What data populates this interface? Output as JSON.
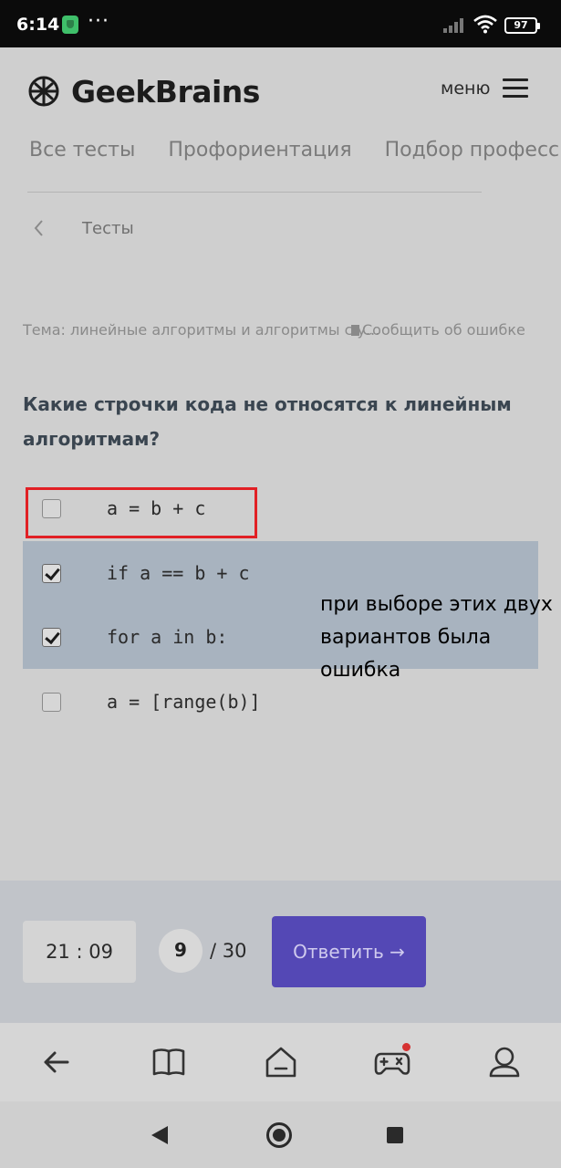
{
  "status_bar": {
    "time": "6:14",
    "more": "···",
    "battery": "97"
  },
  "header": {
    "logo_text": "GeekBrains",
    "menu_label": "меню"
  },
  "tabs": [
    "Все тесты",
    "Профориентация",
    "Подбор профессии"
  ],
  "breadcrumb": {
    "label": "Тесты"
  },
  "topic": {
    "text": "Тема: линейные алгоритмы и алгоритмы с у...",
    "report_label": "Сообщить об ошибке"
  },
  "question": {
    "text": "Какие строчки кода не относятся к линейным алгоритмам?"
  },
  "answers": [
    {
      "code": "a = b + c",
      "checked": false
    },
    {
      "code": "if a == b + c",
      "checked": true
    },
    {
      "code": "for a in b:",
      "checked": true
    },
    {
      "code": "a = [range(b)]",
      "checked": false
    }
  ],
  "annotation_note": "при выборе этих двух вариантов была ошибка",
  "test_bar": {
    "timer": "21 : 09",
    "current_question": "9",
    "total": "/ 30",
    "submit_label": "Ответить →"
  },
  "bottom_nav": {
    "icons": [
      "back-arrow-icon",
      "book-icon",
      "home-icon",
      "gamepad-icon",
      "profile-icon"
    ],
    "has_notification_on": "gamepad-icon"
  },
  "colors": {
    "accent": "#5448b5",
    "highlight": "#a8b3bf",
    "annotation_red": "#e12025"
  }
}
